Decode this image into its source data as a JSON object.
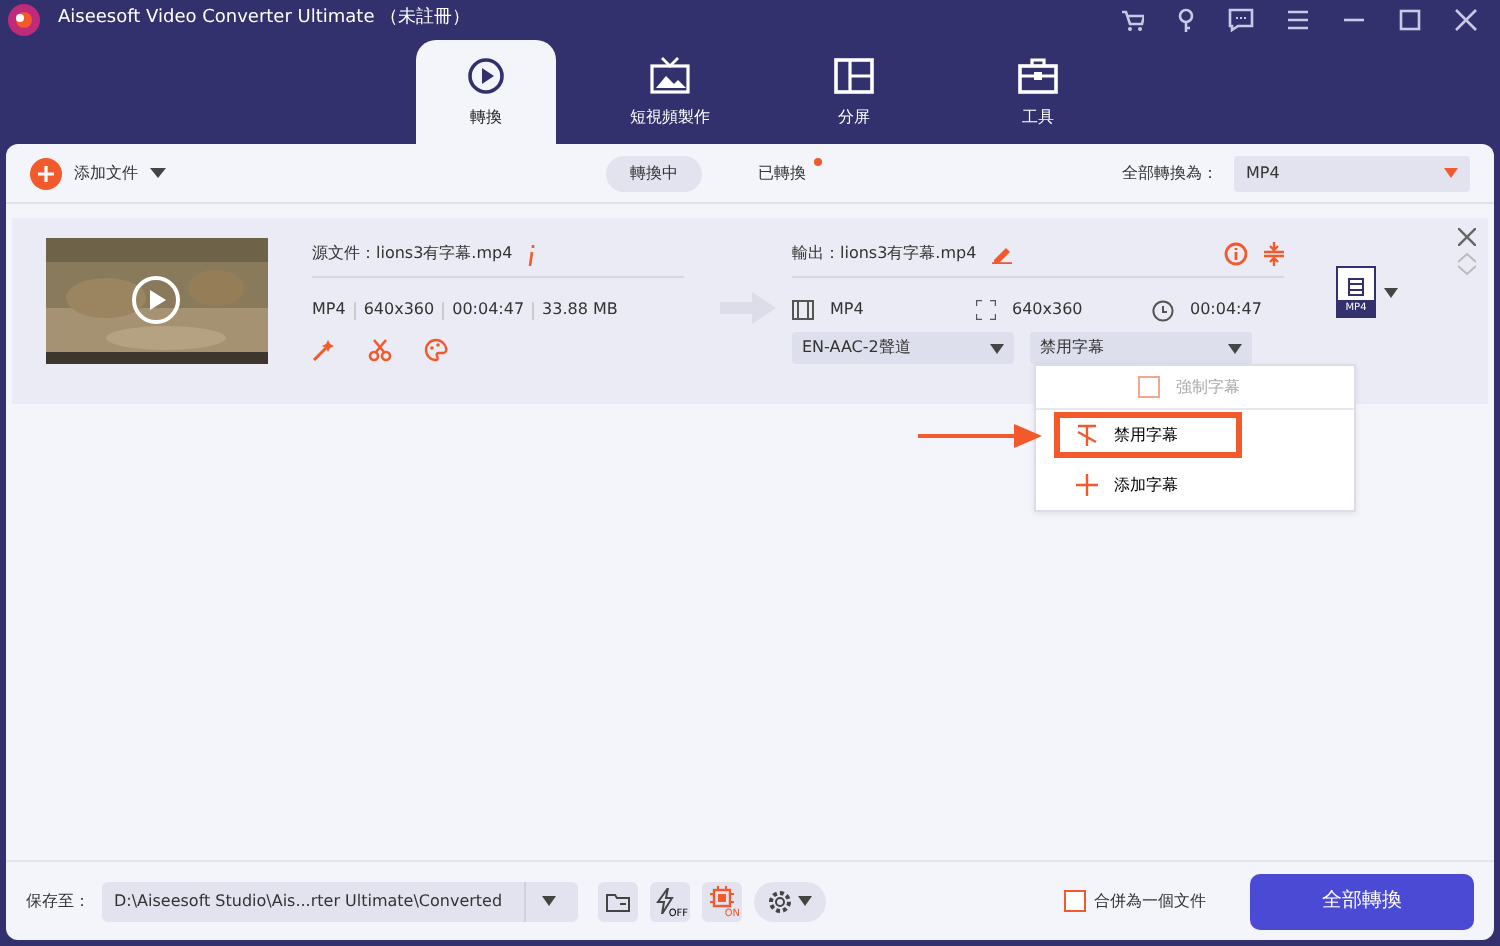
{
  "window": {
    "title": "Aiseesoft Video Converter Ultimate （未註冊）"
  },
  "tabs": [
    {
      "label": "轉換",
      "selected": true
    },
    {
      "label": "短視頻製作",
      "selected": false
    },
    {
      "label": "分屏",
      "selected": false
    },
    {
      "label": "工具",
      "selected": false
    }
  ],
  "toolbar": {
    "add_file": "添加文件",
    "status_tabs": [
      {
        "label": "轉換中",
        "selected": true,
        "dot": false
      },
      {
        "label": "已轉換",
        "selected": false,
        "dot": true
      }
    ],
    "convert_all_label": "全部轉換為：",
    "format": "MP4"
  },
  "file": {
    "source": "源文件：lions3有字幕.mp4",
    "meta": [
      "MP4",
      "640x360",
      "00:04:47",
      "33.88 MB"
    ],
    "output": "輸出：lions3有字幕.mp4",
    "out_format": "MP4",
    "out_resolution": "640x360",
    "out_duration": "00:04:47",
    "audio": "EN-AAC-2聲道",
    "subtitle": "禁用字幕",
    "format_badge": "MP4"
  },
  "subtitle_menu": [
    {
      "kind": "checkbox",
      "label": "強制字幕",
      "checked": false,
      "disabled": true,
      "highlighted": false
    },
    {
      "kind": "disable",
      "label": "禁用字幕",
      "disabled": false,
      "highlighted": true
    },
    {
      "kind": "add",
      "label": "添加字幕",
      "disabled": false,
      "highlighted": false
    }
  ],
  "footer": {
    "save_label": "保存至：",
    "path": "D:\\Aiseesoft Studio\\Ais...rter Ultimate\\Converted",
    "accel_off": "OFF",
    "gpu_on": "ON",
    "merge": {
      "label": "合併為一個文件",
      "checked": false
    },
    "convert_button": "全部轉換"
  }
}
